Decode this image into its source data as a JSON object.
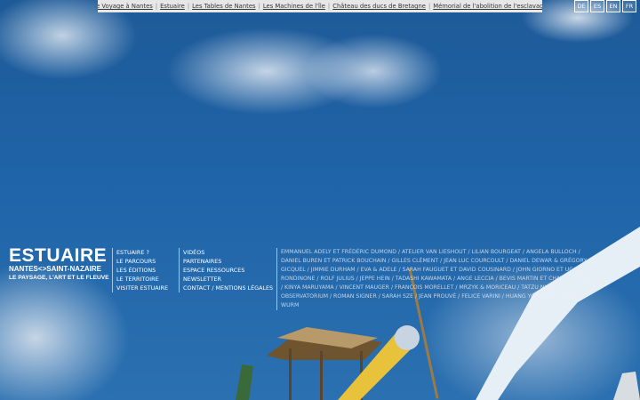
{
  "topbar": {
    "links": [
      "Le Voyage à Nantes",
      "Estuaire",
      "Les Tables de Nantes",
      "Les Machines de l'île",
      "Château des ducs de Bretagne",
      "Mémorial de l'abolition de l'esclavage"
    ]
  },
  "languages": [
    "DE",
    "ES",
    "EN",
    "FR"
  ],
  "logo": {
    "title": "ESTUAIRE",
    "subtitle": "NANTES<>SAINT-NAZAIRE",
    "tagline": "LE PAYSAGE, L'ART ET LE FLEUVE"
  },
  "nav_col1": [
    "ESTUAIRE ?",
    "LE PARCOURS",
    "LES ÉDITIONS",
    "LE TERRITOIRE",
    "VISITER ESTUAIRE"
  ],
  "nav_col2": [
    "VIDÉOS",
    "PARTENAIRES",
    "ESPACE RESSOURCES",
    "NEWSLETTER",
    "CONTACT / MENTIONS LÉGALES"
  ],
  "artists_text": "EMMANUEL ADELY ET FRÉDÉRIC DUMOND / ATELIER VAN LIESHOUT / LILIAN BOURGEAT / ANGELA BULLOCH / DANIEL BUREN ET PATRICK BOUCHAIN / GILLES CLÉMENT / JEAN LUC COURCOULT / DANIEL DEWAR & GRÉGORY GICQUEL / JIMMIE DURHAM / EVA & ADELE / SARAH FAUGUET ET DAVID COUSINARD / JOHN GIORNO ET UGO RONDINONE / ROLF JULIUS / JEPPE HEIN / TADASHI KAWAMATA / ANGE LECCIA / BEVIS MARTIN ET CHARLIE YOULE / KINYA MARUYAMA / VINCENT MAUGER / FRANÇOIS MORELLET / MRZYK & MORICEAU / TATZU NISHI / OBSERVATORIUM / ROMAN SIGNER / SARAH SZE / JEAN PROUVÉ / FELICE VARINI / HUANG YONG PING / ERWIN WURM"
}
